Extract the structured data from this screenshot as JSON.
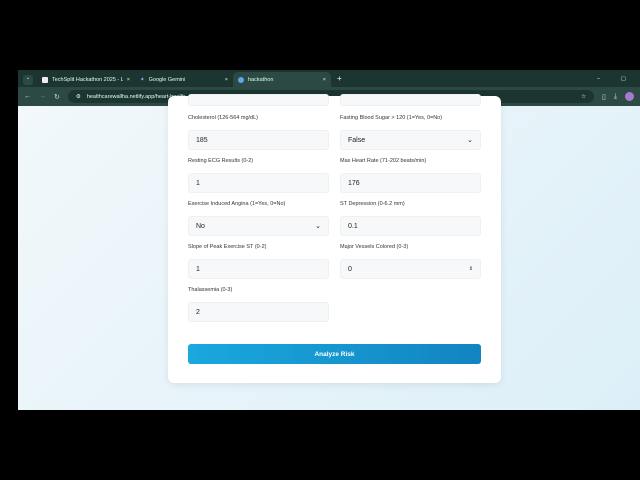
{
  "browser": {
    "tabs": [
      {
        "label": "TechSplit Hackathon 2025 - L"
      },
      {
        "label": "Google Gemini"
      },
      {
        "label": "hackathon"
      }
    ],
    "new_tab": "+",
    "url": "healthcarewallha.netlify.app/heart-health"
  },
  "form": {
    "fields": [
      {
        "label": "Cholesterol (126-564 mg/dL)",
        "value": "185"
      },
      {
        "label": "Fasting Blood Sugar > 120 (1=Yes, 0=No)",
        "value": "False"
      },
      {
        "label": "Resting ECG Results (0-2)",
        "value": "1"
      },
      {
        "label": "Max Heart Rate (71-202 beats/min)",
        "value": "176"
      },
      {
        "label": "Exercise Induced Angina (1=Yes, 0=No)",
        "value": "No"
      },
      {
        "label": "ST Depression (0-6.2 mm)",
        "value": "0.1"
      },
      {
        "label": "Slope of Peak Exercise ST (0-2)",
        "value": "1"
      },
      {
        "label": "Major Vessels Colored (0-3)",
        "value": "0"
      },
      {
        "label": "Thalassemia (0-3)",
        "value": "2"
      }
    ],
    "submit": "Analyze Risk"
  }
}
